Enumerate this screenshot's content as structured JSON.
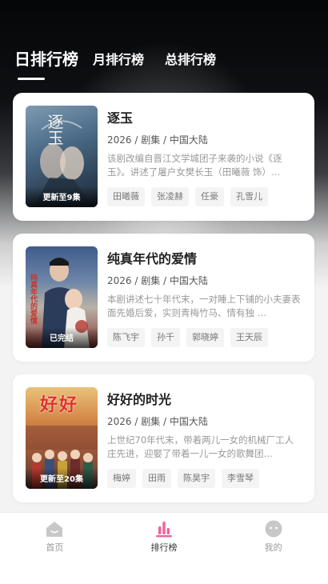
{
  "tabs": [
    {
      "label": "日排行榜",
      "active": true
    },
    {
      "label": "月排行榜",
      "active": false
    },
    {
      "label": "总排行榜",
      "active": false
    }
  ],
  "dramas": [
    {
      "title": "逐玉",
      "meta": "2026 / 剧集 / 中国大陆",
      "description": "该剧改编自晋江文学城团子来袭的小说《逐玉》。讲述了屠户女樊长玉（田曦薇 饰）…",
      "poster_status": "更新至9集",
      "poster_text": "逐玉",
      "tags": [
        "田曦薇",
        "张凌赫",
        "任豪",
        "孔雪儿"
      ]
    },
    {
      "title": "纯真年代的爱情",
      "meta": "2026 / 剧集 / 中国大陆",
      "description": "本剧讲述七十年代末，一对睡上下铺的小夫妻表面先婚后爱，实则青梅竹马、情有独 …",
      "poster_status": "已完结",
      "poster_text": "纯真年代的爱情",
      "tags": [
        "陈飞宇",
        "孙千",
        "郭晓婷",
        "王天辰"
      ]
    },
    {
      "title": "好好的时光",
      "meta": "2026 / 剧集 / 中国大陆",
      "description": "上世纪70年代末，带着两儿一女的机械厂工人庄先进，迎娶了带着一儿一女的歌舞团…",
      "poster_status": "更新至20集",
      "poster_text": "好好",
      "tags": [
        "梅婷",
        "田雨",
        "陈昊宇",
        "李雪琴"
      ]
    }
  ],
  "nav": [
    {
      "label": "首页",
      "icon": "home-icon",
      "active": false
    },
    {
      "label": "排行榜",
      "icon": "ranking-icon",
      "active": true
    },
    {
      "label": "我的",
      "icon": "profile-icon",
      "active": false
    }
  ],
  "colors": {
    "accent": "#f0609a",
    "inactive": "#c8c8c8"
  }
}
